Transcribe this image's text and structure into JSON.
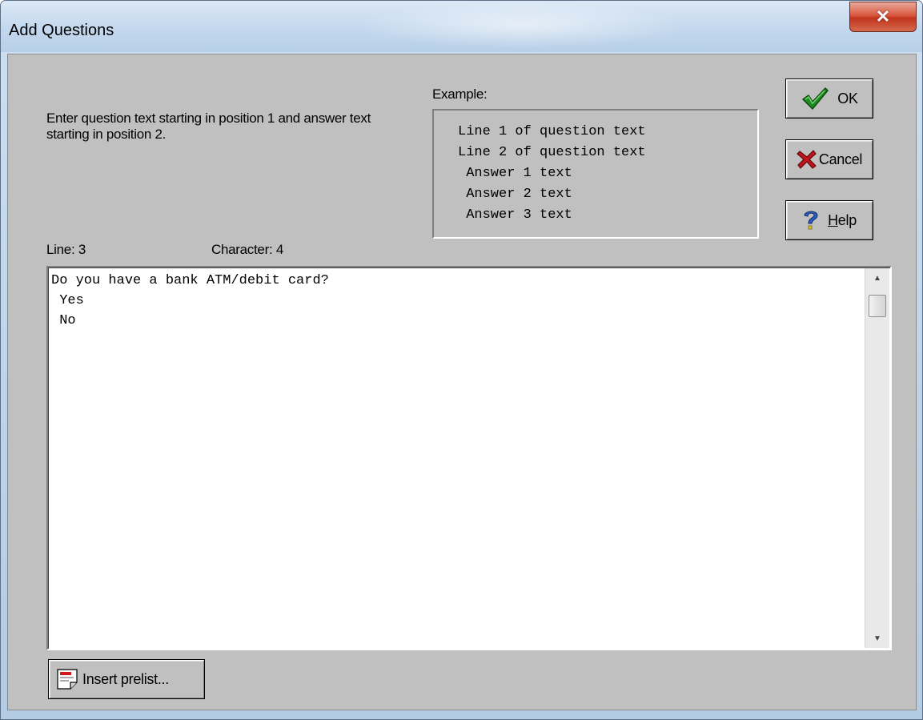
{
  "window": {
    "title": "Add Questions",
    "close_glyph": "✕"
  },
  "instructions": "Enter question text starting in position 1 and answer text starting in position 2.",
  "example": {
    "label": "Example:",
    "lines": [
      "Line 1 of question text",
      "Line 2 of question text",
      " Answer 1 text",
      " Answer 2 text",
      " Answer 3 text"
    ]
  },
  "buttons": {
    "ok": {
      "label": "OK",
      "icon": "checkmark-icon",
      "color": "#1f8a1f"
    },
    "cancel": {
      "label": "Cancel",
      "icon": "red-x-icon",
      "color": "#c0141c"
    },
    "help": {
      "label_underlined": "H",
      "label_rest": "elp",
      "icon": "question-mark-icon",
      "color": "#2a5fbf"
    },
    "insert_prelist": {
      "label": "Insert prelist...",
      "icon": "document-icon"
    }
  },
  "status": {
    "line_label": "Line:",
    "line_value": "3",
    "character_label": "Character:",
    "character_value": "4"
  },
  "editor": {
    "lines": [
      "Do you have a bank ATM/debit card?",
      " Yes",
      " No"
    ]
  }
}
